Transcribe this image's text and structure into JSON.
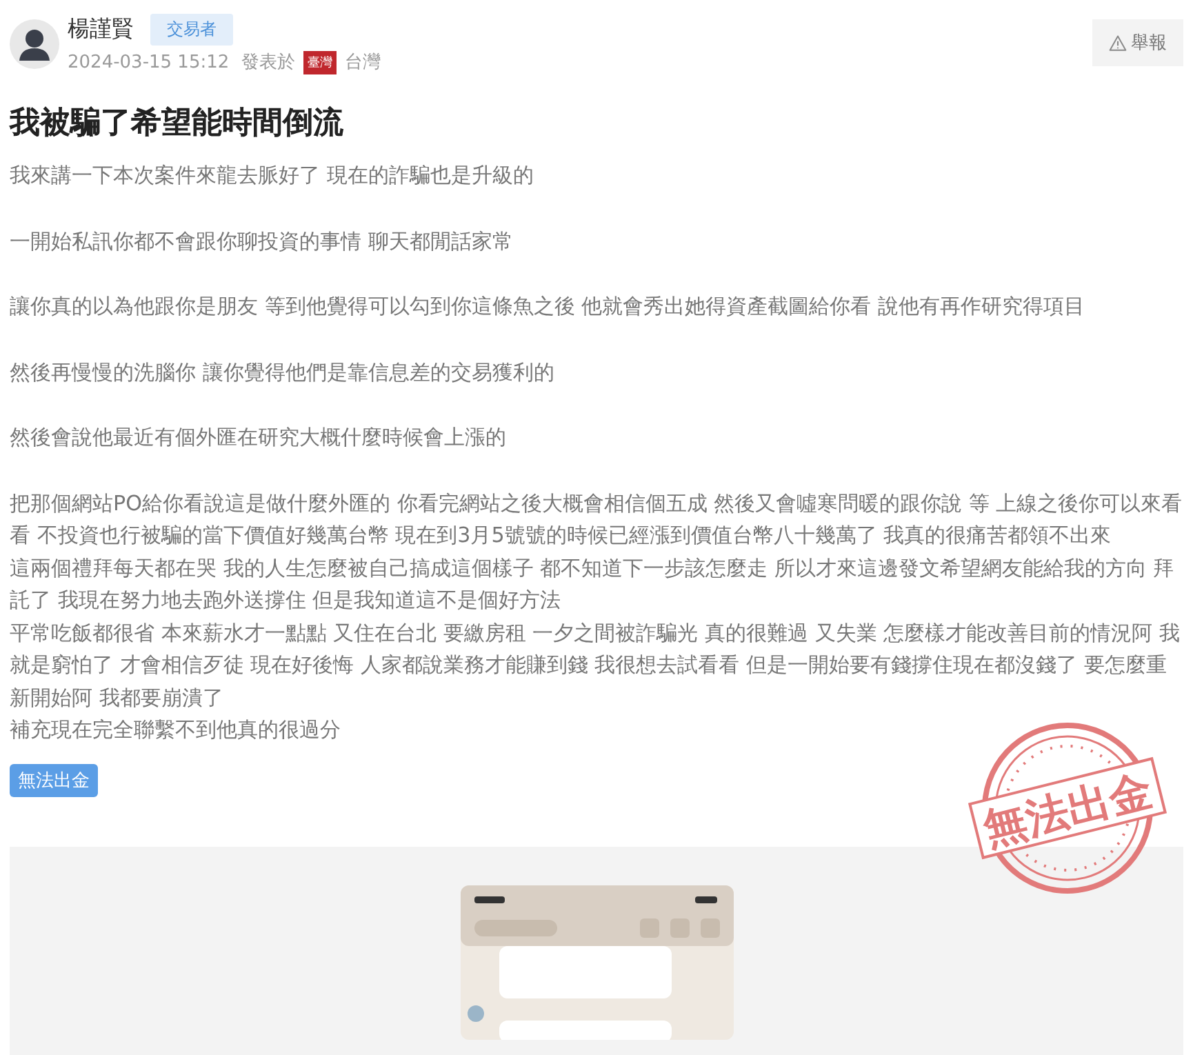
{
  "author": {
    "name": "楊謹賢",
    "role_badge": "交易者",
    "date": "2024-03-15 15:12",
    "posted_from_label": "發表於",
    "flag_label": "臺灣",
    "location": "台灣"
  },
  "report_button": {
    "label": "舉報"
  },
  "title": "我被騙了希望能時間倒流",
  "paragraphs": [
    {
      "lines": [
        "我來講一下本次案件來龍去脈好了 現在的詐騙也是升級的"
      ]
    },
    {
      "lines": [
        "一開始私訊你都不會跟你聊投資的事情 聊天都閒話家常"
      ]
    },
    {
      "lines": [
        "讓你真的以為他跟你是朋友 等到他覺得可以勾到你這條魚之後 他就會秀出她得資產截圖給你看 說他有再作研究得項目"
      ]
    },
    {
      "lines": [
        "然後再慢慢的洗腦你 讓你覺得他們是靠信息差的交易獲利的"
      ]
    },
    {
      "lines": [
        "然後會說他最近有個外匯在研究大概什麼時候會上漲的"
      ]
    },
    {
      "lines": [
        "把那個網站PO給你看說這是做什麼外匯的 你看完網站之後大概會相信個五成 然後又會噓寒問暖的跟你說 等 上線之後你可以來看看 不投資也行被騙的當下價值好幾萬台幣 現在到3月5號號的時候已經漲到價值台幣八十幾萬了 我真的很痛苦都領不出來",
        "這兩個禮拜每天都在哭 我的人生怎麼被自己搞成這個樣子 都不知道下一步該怎麼走 所以才來這邊發文希望網友能給我的方向 拜託了 我現在努力地去跑外送撐住 但是我知道這不是個好方法",
        "平常吃飯都很省 本來薪水才一點點 又住在台北 要繳房租 一夕之間被詐騙光 真的很難過 又失業 怎麼樣才能改善目前的情況阿 我就是窮怕了 才會相信歹徒 現在好後悔 人家都說業務才能賺到錢 我很想去試看看 但是一開始要有錢撐住現在都沒錢了 要怎麼重新開始阿 我都要崩潰了",
        "補充現在完全聯繫不到他真的很過分"
      ]
    }
  ],
  "tags": [
    "無法出金"
  ],
  "stamp": {
    "text": "無法出金"
  }
}
